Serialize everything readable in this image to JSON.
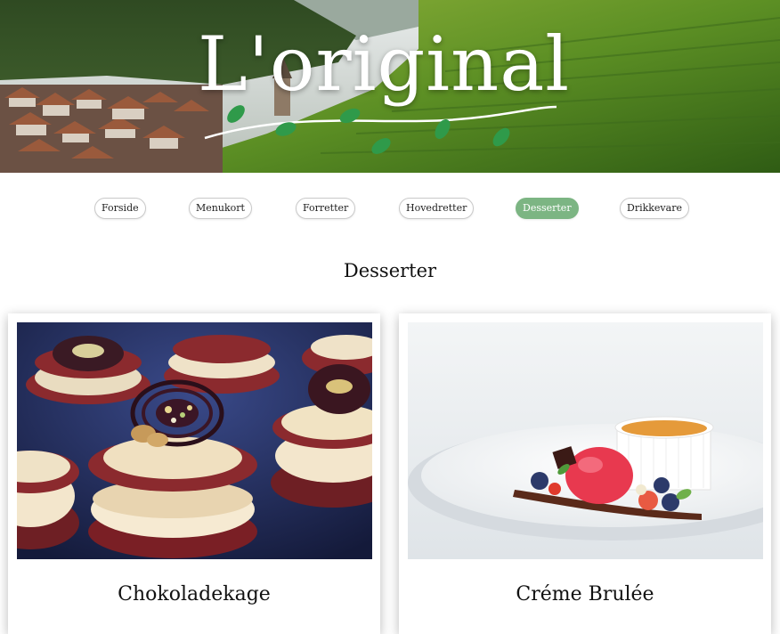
{
  "brand": {
    "title": "L'original"
  },
  "nav": {
    "items": [
      {
        "label": "Forside",
        "active": false
      },
      {
        "label": "Menukort",
        "active": false
      },
      {
        "label": "Forretter",
        "active": false
      },
      {
        "label": "Hovedretter",
        "active": false
      },
      {
        "label": "Desserter",
        "active": true
      },
      {
        "label": "Drikkevare",
        "active": false
      }
    ]
  },
  "page": {
    "title": "Desserter"
  },
  "cards": [
    {
      "title": "Chokoladekage",
      "image": "chocolate-cake-photo"
    },
    {
      "title": "Créme Brulée",
      "image": "creme-brulee-photo"
    }
  ],
  "colors": {
    "nav_active": "#7cb583",
    "leaf": "#2f9a4a"
  }
}
